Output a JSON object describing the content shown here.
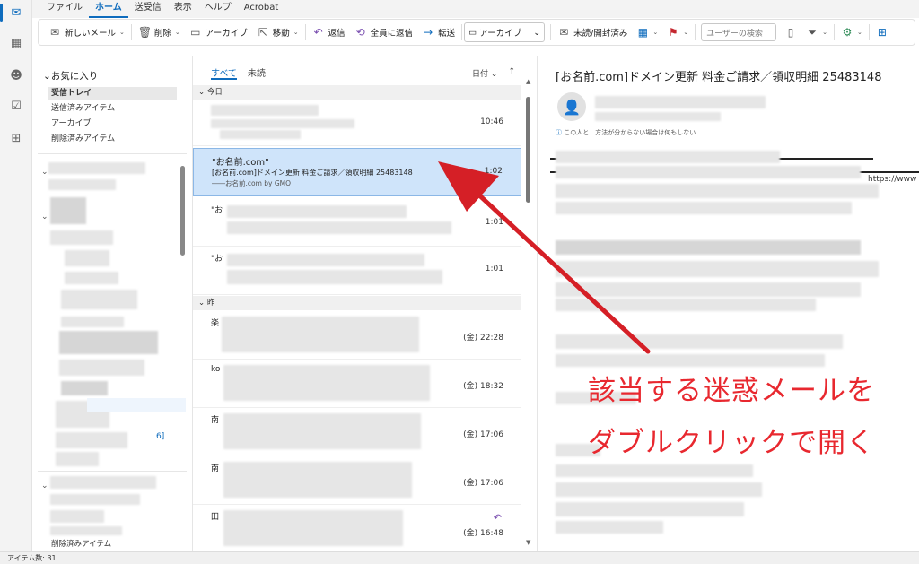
{
  "menu": [
    "ファイル",
    "ホーム",
    "送受信",
    "表示",
    "ヘルプ",
    "Acrobat"
  ],
  "menu_selected": "ホーム",
  "ribbon": {
    "new_mail": "新しいメール",
    "delete": "削除",
    "archive": "アーカイブ",
    "move": "移動",
    "reply": "返信",
    "reply_all": "全員に返信",
    "forward": "転送",
    "quick_step": "アーカイブ",
    "read_unread": "未読/開封済み",
    "search_placeholder": "ユーザーの検索"
  },
  "folders": {
    "favorites_header": "お気に入り",
    "items": [
      "受信トレイ",
      "送信済みアイテム",
      "アーカイブ",
      "削除済みアイテム"
    ],
    "badge": "6]",
    "bottom_item": "削除済みアイテム"
  },
  "list": {
    "tab_all": "すべて",
    "tab_unread": "未読",
    "sort_label": "日付",
    "group_today": "今日",
    "group_yesterday": "昨",
    "selected": {
      "from": "\"お名前.com\"",
      "subject": "[お名前.com]ドメイン更新 料金ご請求／領収明細 25483148",
      "preview": "――お名前.com by GMO",
      "time": "1:02"
    },
    "times": [
      "10:46",
      "1:02",
      "1:01",
      "1:01",
      "(金) 22:28",
      "(金) 18:32",
      "(金) 17:06",
      "(金) 17:06",
      "(金) 16:48"
    ],
    "initials": [
      "\"お",
      "\"お",
      "楽",
      "ko",
      "南",
      "南",
      "田"
    ]
  },
  "reading": {
    "title": "[お名前.com]ドメイン更新 料金ご請求／領収明細 25483148",
    "info_note": "この人と…方法が分からない場合は何もしない",
    "url_snippet": "https://www"
  },
  "annotation": {
    "line1": "該当する迷惑メールを",
    "line2": "ダブルクリックで開く",
    "color": "#e8282f"
  },
  "status": "アイテム数: 31"
}
